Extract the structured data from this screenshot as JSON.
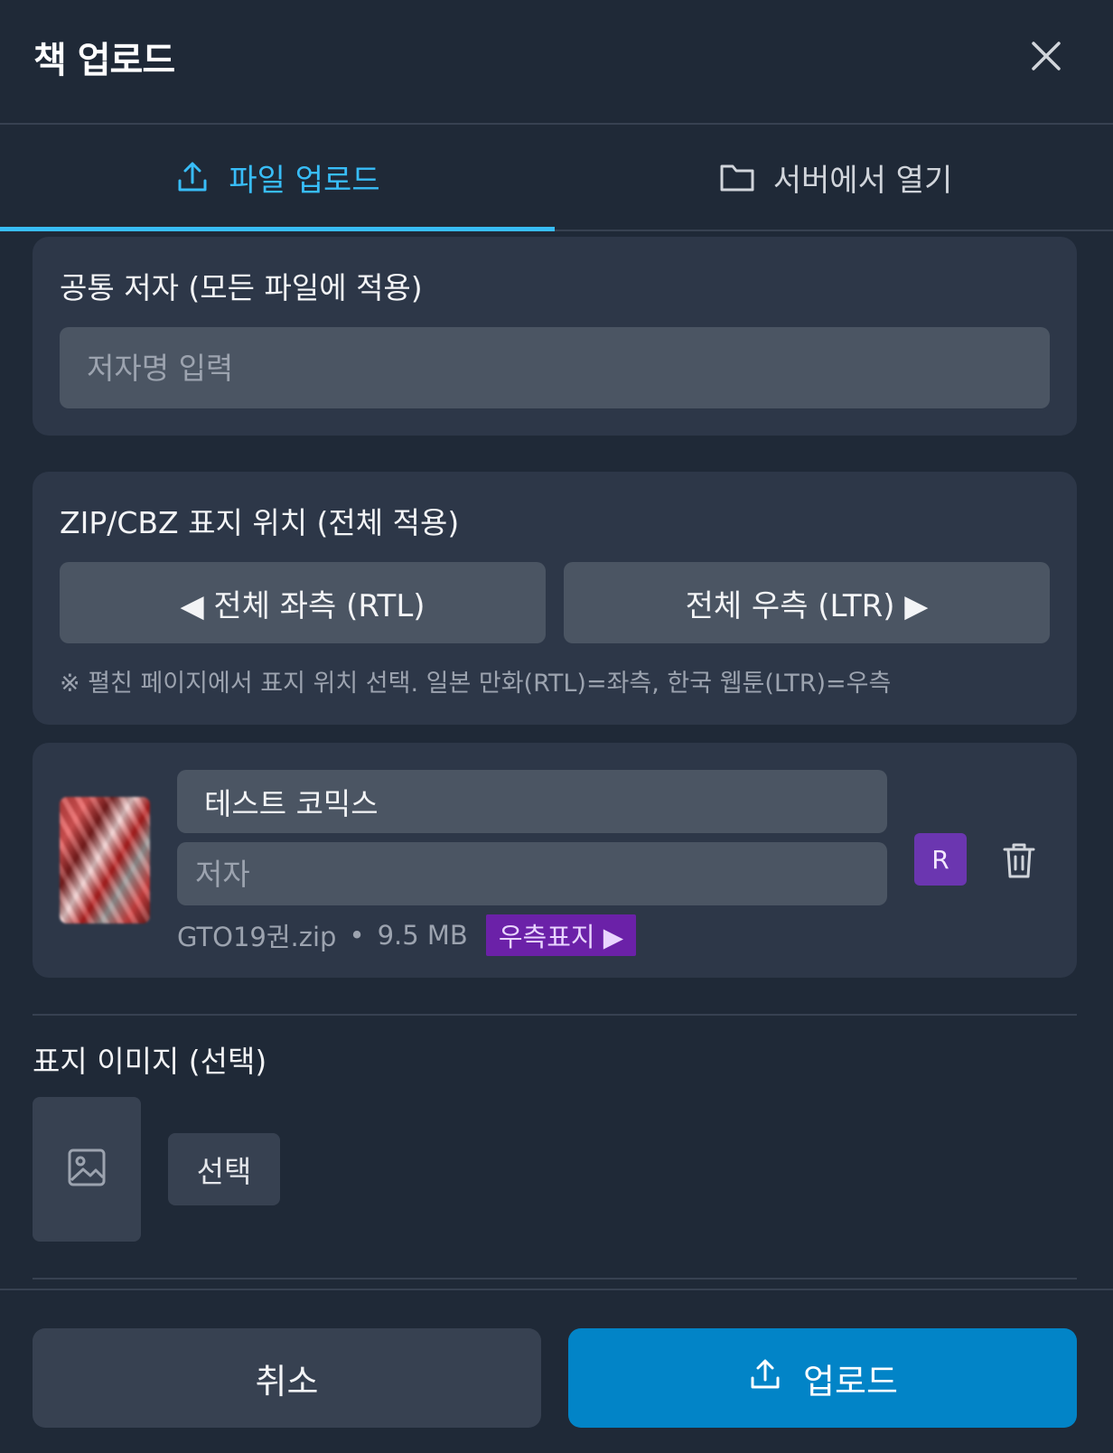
{
  "header": {
    "title": "책 업로드"
  },
  "tabs": [
    {
      "label": "파일 업로드",
      "icon": "upload-icon",
      "active": true
    },
    {
      "label": "서버에서 열기",
      "icon": "folder-icon",
      "active": false
    }
  ],
  "author_section": {
    "label": "공통 저자 (모든 파일에 적용)",
    "placeholder": "저자명 입력",
    "value": ""
  },
  "cover_position_section": {
    "label": "ZIP/CBZ 표지 위치 (전체 적용)",
    "left_button": "◀ 전체 좌측 (RTL)",
    "right_button": "전체 우측 (LTR) ▶",
    "note": "※ 펼친 페이지에서 표지 위치 선택. 일본 만화(RTL)=좌측, 한국 웹툰(LTR)=우측"
  },
  "file_item": {
    "title_value": "테스트 코믹스",
    "author_placeholder": "저자",
    "filename": "GTO19권.zip",
    "separator": "•",
    "size": "9.5 MB",
    "direction_badge": "우측표지 ▶",
    "r_badge": "R",
    "colors": {
      "badge": "#6b21a8",
      "r_badge": "#6b36b0"
    }
  },
  "cover_image": {
    "label": "표지 이미지 (선택)",
    "select_button": "선택",
    "placeholder_icon": "image-icon"
  },
  "footer": {
    "cancel": "취소",
    "upload": "업로드"
  },
  "colors": {
    "background": "#1f2937",
    "card": "#2d3748",
    "accent": "#38bdf8",
    "primary_button": "#0284c7"
  }
}
